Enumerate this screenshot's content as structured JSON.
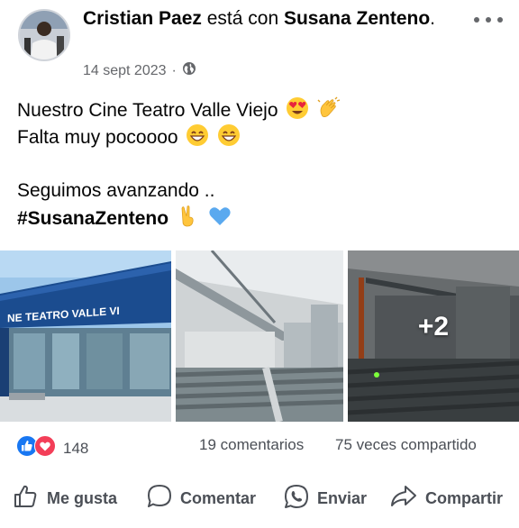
{
  "post": {
    "author": "Cristian Paez",
    "connector": "está con",
    "tagged": "Susana Zenteno",
    "date": "14 sept 2023",
    "privacy_icon": "globe-icon",
    "text_lines": [
      "Nuestro Cine Teatro Valle Viejo",
      "Falta muy pocoooo",
      "Seguimos avanzando ..",
      "#SusanaZenteno"
    ],
    "photo_sign_text": "NE TEATRO VALLE VI",
    "more_photos": "+2"
  },
  "stats": {
    "reaction_icons": [
      "like-icon",
      "love-icon"
    ],
    "reactions_count": "148",
    "comments": "19 comentarios",
    "shares": "75 veces compartido"
  },
  "actions": {
    "like": "Me gusta",
    "comment": "Comentar",
    "send": "Enviar",
    "share": "Compartir"
  },
  "colors": {
    "like_blue": "#1877f2",
    "love_red": "#f33e58",
    "secondary_text": "#65676b",
    "action_text": "#4b4f56"
  }
}
